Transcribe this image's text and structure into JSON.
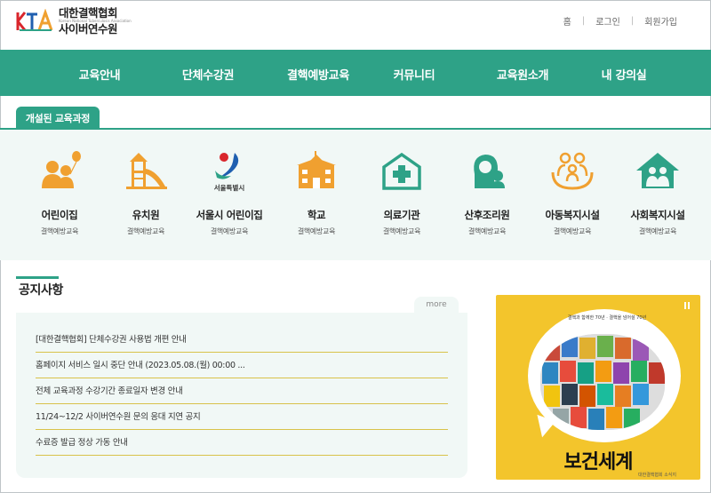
{
  "header": {
    "logo": {
      "line1": "대한결핵협회",
      "line2": "사이버연수원",
      "sub": "Korean National Tuberculosis Association"
    },
    "links": [
      {
        "label": "홈"
      },
      {
        "label": "로그인"
      },
      {
        "label": "회원가입"
      }
    ]
  },
  "nav": {
    "items": [
      {
        "label": "교육안내"
      },
      {
        "label": "단체수강권"
      },
      {
        "label": "결핵예방교육"
      },
      {
        "label": "커뮤니티"
      },
      {
        "label": "교육원소개"
      },
      {
        "label": "내 강의실"
      }
    ]
  },
  "courses": {
    "tab_label": "개설된 교육과정",
    "items": [
      {
        "name": "어린이집",
        "desc": "결핵예방교육",
        "icon": "children-balloon-icon"
      },
      {
        "name": "유치원",
        "desc": "결핵예방교육",
        "icon": "playground-slide-icon"
      },
      {
        "name": "서울시 어린이집",
        "desc": "결핵예방교육",
        "icon": "seoul-city-logo-icon",
        "logo_text": "서울특별시"
      },
      {
        "name": "학교",
        "desc": "결핵예방교육",
        "icon": "school-building-icon"
      },
      {
        "name": "의료기관",
        "desc": "결핵예방교육",
        "icon": "hospital-cross-icon"
      },
      {
        "name": "산후조리원",
        "desc": "결핵예방교육",
        "icon": "mother-baby-icon"
      },
      {
        "name": "아동복지시설",
        "desc": "결핵예방교육",
        "icon": "family-care-icon"
      },
      {
        "name": "사회복지시설",
        "desc": "결핵예방교육",
        "icon": "house-family-icon"
      }
    ]
  },
  "notice": {
    "title": "공지사항",
    "more_label": "more",
    "items": [
      {
        "text": "[대한결핵협회] 단체수강권 사용법 개편 안내"
      },
      {
        "text": "홈페이지 서비스 일시 중단 안내 (2023.05.08.(월) 00:00 ..."
      },
      {
        "text": "전체 교육과정 수강기간 종료일자 변경 안내"
      },
      {
        "text": "11/24~12/2 사이버연수원 문의 응대 지연 공지"
      },
      {
        "text": "수료증 발급 정상 가동 안내"
      }
    ]
  },
  "banner": {
    "title": "보건세계",
    "top_text": "결핵과 함께한 70년 · 결핵을 넘어설 70년",
    "foot_text": "대한결핵협회 소식지"
  },
  "colors": {
    "primary": "#2ea287",
    "icon_orange": "#f0a030",
    "icon_green": "#2ea287",
    "section_bg": "#f1f8f6",
    "divider_gold": "#d8c24a",
    "banner_yellow": "#f3c52c"
  }
}
